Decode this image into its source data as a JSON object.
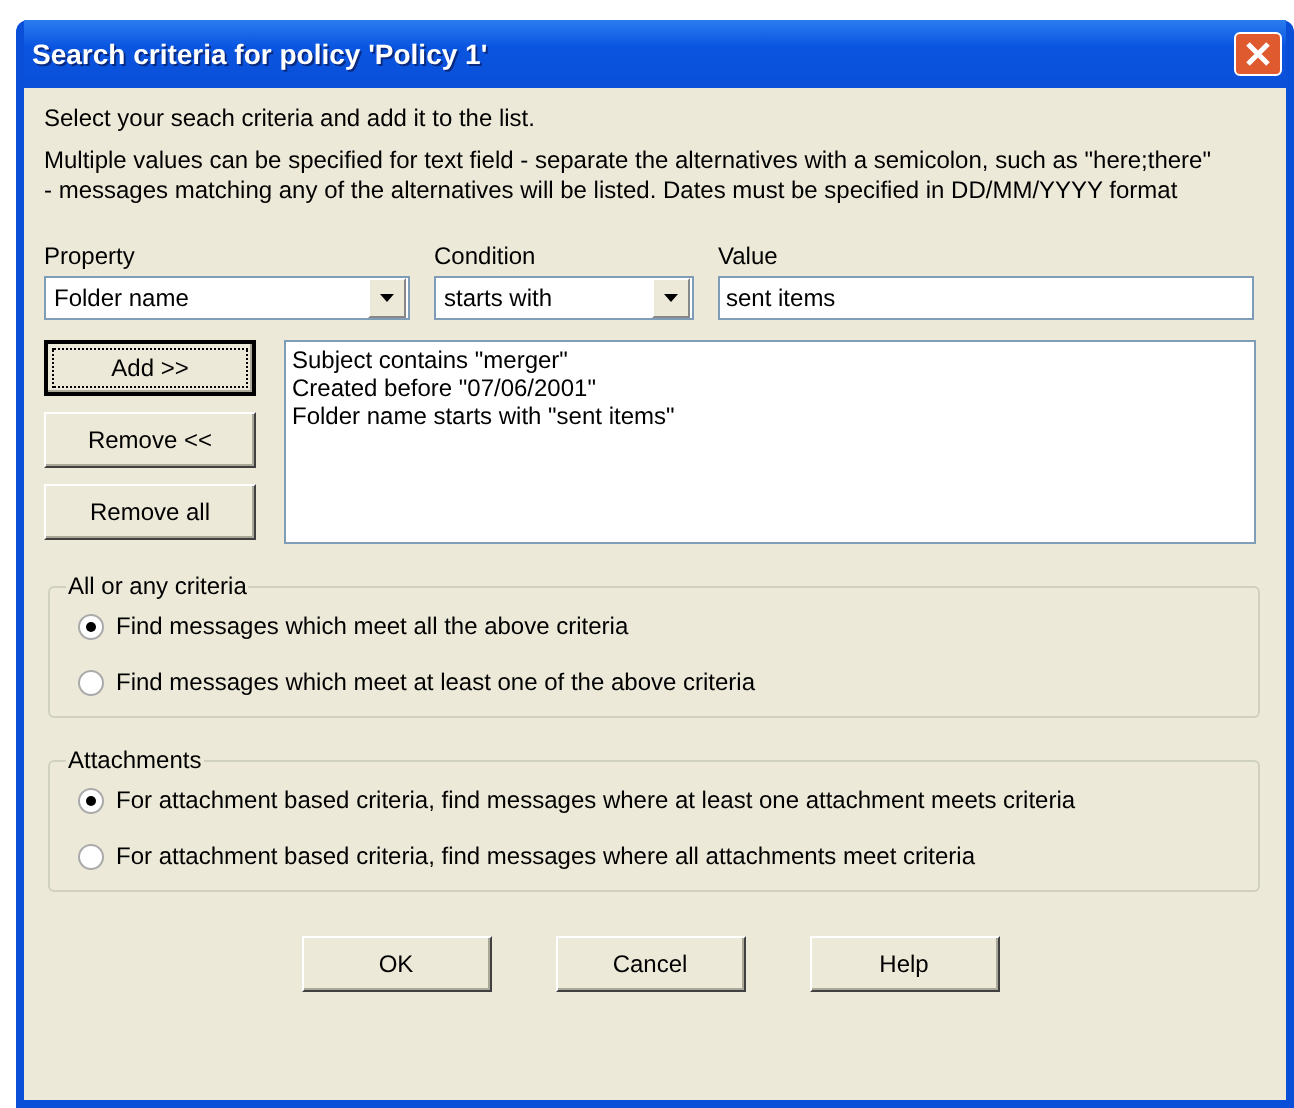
{
  "window": {
    "title": "Search criteria for policy 'Policy 1'"
  },
  "intro": "Select your seach criteria and add it to the list.",
  "help_text": "Multiple values can be specified for text field - separate the alternatives with a semicolon, such as \"here;there\" - messages matching any of the alternatives will be listed. Dates must be specified in DD/MM/YYYY format",
  "property": {
    "label": "Property",
    "value": "Folder name"
  },
  "condition": {
    "label": "Condition",
    "value": "starts with"
  },
  "value": {
    "label": "Value",
    "value": "sent items"
  },
  "side_buttons": [
    {
      "label": "Add >>",
      "focused": true
    },
    {
      "label": "Remove <<",
      "focused": false
    },
    {
      "label": "Remove all",
      "focused": false
    }
  ],
  "criteria_list": [
    "Subject contains \"merger\"",
    "Created before \"07/06/2001\"",
    "Folder name starts with \"sent items\""
  ],
  "groups": [
    {
      "title": "All or any criteria",
      "options": [
        {
          "label": "Find messages which meet all the above criteria",
          "selected": true
        },
        {
          "label": "Find messages which meet at least one of the above criteria",
          "selected": false
        }
      ]
    },
    {
      "title": "Attachments",
      "options": [
        {
          "label": "For attachment based criteria, find messages where at least one attachment meets criteria",
          "selected": true
        },
        {
          "label": "For attachment based criteria, find messages where all attachments meet criteria",
          "selected": false
        }
      ]
    }
  ],
  "buttons": [
    "OK",
    "Cancel",
    "Help"
  ]
}
